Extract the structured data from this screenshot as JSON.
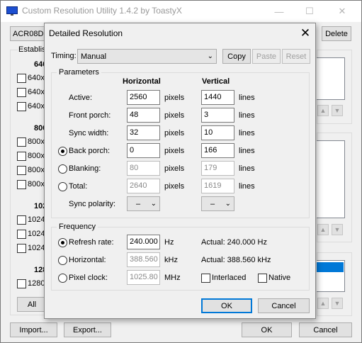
{
  "main": {
    "title": "Custom Resolution Utility 1.4.2 by ToastyX",
    "monitor_combo_value": "ACR08DE",
    "delete_label": "Delete",
    "established_label": "Establis",
    "all_label": "All",
    "groups": [
      {
        "header": "640",
        "items": [
          "640x",
          "640x",
          "640x"
        ]
      },
      {
        "header": "800",
        "items": [
          "800x",
          "800x",
          "800x",
          "800x"
        ]
      },
      {
        "header": "102",
        "items": [
          "1024",
          "1024",
          "1024"
        ]
      },
      {
        "header": "128",
        "items": [
          "1280"
        ]
      }
    ],
    "import_label": "Import...",
    "export_label": "Export...",
    "ok_label": "OK",
    "cancel_label": "Cancel"
  },
  "dialog": {
    "title": "Detailed Resolution",
    "timing_label": "Timing:",
    "timing_value": "Manual",
    "copy_label": "Copy",
    "paste_label": "Paste",
    "reset_label": "Reset",
    "parameters_label": "Parameters",
    "horizontal_header": "Horizontal",
    "vertical_header": "Vertical",
    "rows": [
      {
        "label": "Active:",
        "h": "2560",
        "h_unit": "pixels",
        "v": "1440",
        "v_unit": "lines"
      },
      {
        "label": "Front porch:",
        "h": "48",
        "h_unit": "pixels",
        "v": "3",
        "v_unit": "lines"
      },
      {
        "label": "Sync width:",
        "h": "32",
        "h_unit": "pixels",
        "v": "10",
        "v_unit": "lines"
      },
      {
        "label": "Back porch:",
        "h": "0",
        "h_unit": "pixels",
        "v": "166",
        "v_unit": "lines"
      },
      {
        "label": "Blanking:",
        "h": "80",
        "h_unit": "pixels",
        "v": "179",
        "v_unit": "lines"
      },
      {
        "label": "Total:",
        "h": "2640",
        "h_unit": "pixels",
        "v": "1619",
        "v_unit": "lines"
      }
    ],
    "sync_polarity_label": "Sync polarity:",
    "sync_h_value": "–",
    "sync_v_value": "–",
    "frequency_label": "Frequency",
    "refresh_label": "Refresh rate:",
    "refresh_value": "240.000",
    "refresh_unit": "Hz",
    "refresh_actual": "Actual: 240.000 Hz",
    "horizontal_label": "Horizontal:",
    "horizontal_value": "388.560",
    "horizontal_unit": "kHz",
    "horizontal_actual": "Actual: 388.560 kHz",
    "pixel_clock_label": "Pixel clock:",
    "pixel_clock_value": "1025.80",
    "pixel_clock_unit": "MHz",
    "interlaced_label": "Interlaced",
    "native_label": "Native",
    "ok_label": "OK",
    "cancel_label": "Cancel"
  },
  "colors": {
    "accent": "#0078d7",
    "selection": "#0078d7"
  }
}
